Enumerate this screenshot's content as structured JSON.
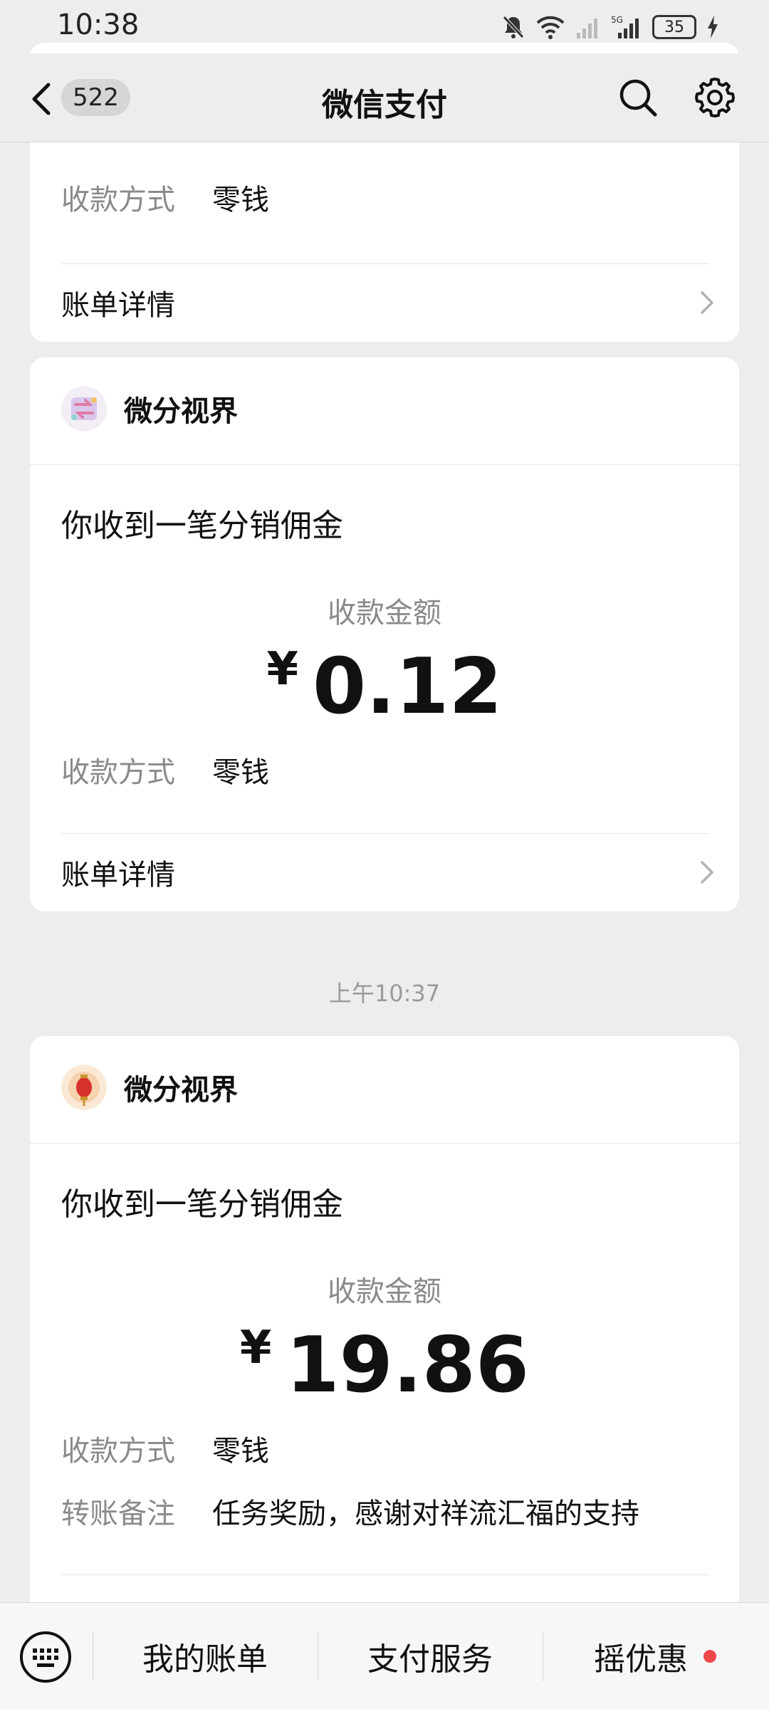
{
  "status_bar": {
    "time": "10:38",
    "battery": "35"
  },
  "nav": {
    "back_count": "522",
    "title": "微信支付"
  },
  "cards": [
    {
      "pay_method_label": "收款方式",
      "pay_method_value": "零钱",
      "detail_label": "账单详情"
    },
    {
      "merchant": "微分视界",
      "notice": "你收到一笔分销佣金",
      "amount_label": "收款金额",
      "currency": "¥",
      "amount": "0.12",
      "pay_method_label": "收款方式",
      "pay_method_value": "零钱",
      "detail_label": "账单详情"
    },
    {
      "merchant": "微分视界",
      "notice": "你收到一笔分销佣金",
      "amount_label": "收款金额",
      "currency": "¥",
      "amount": "19.86",
      "pay_method_label": "收款方式",
      "pay_method_value": "零钱",
      "remark_label": "转账备注",
      "remark_value": "任务奖励，感谢对祥流汇福的支持"
    }
  ],
  "timestamp": "上午10:37",
  "bottom_tabs": [
    "我的账单",
    "支付服务",
    "摇优惠"
  ],
  "colors": {
    "background": "#ededed",
    "card": "#ffffff",
    "badge_dot": "#f0474a"
  }
}
